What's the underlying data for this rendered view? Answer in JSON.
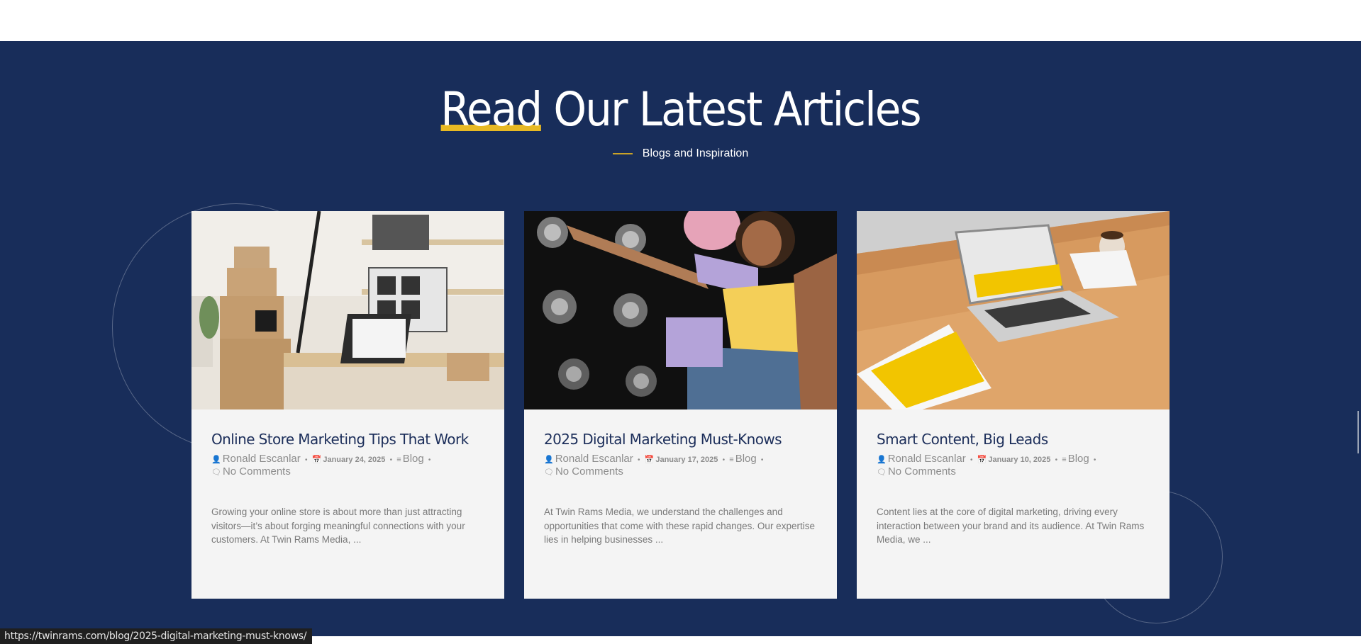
{
  "section": {
    "heading_highlight": "Read",
    "heading_rest": " Our Latest Articles",
    "subheading": "Blogs and Inspiration"
  },
  "colors": {
    "section_bg": "#182d5a",
    "accent": "#e8b923",
    "title": "#1c2e5a"
  },
  "cards": [
    {
      "title": "Online Store Marketing Tips That Work",
      "author": "Ronald Escanlar",
      "date": "January 24, 2025",
      "category": "Blog",
      "comments": "No Comments",
      "excerpt": "Growing your online store is about more than just attracting visitors—it’s about forging meaningful connections with your customers. At Twin Rams Media, ..."
    },
    {
      "title": "2025 Digital Marketing Must-Knows",
      "author": "Ronald Escanlar",
      "date": "January 17, 2025",
      "category": "Blog",
      "comments": "No Comments",
      "excerpt": "At Twin Rams Media, we understand the challenges and opportunities that come with these rapid changes. Our expertise lies in helping businesses ..."
    },
    {
      "title": "Smart Content, Big Leads",
      "author": "Ronald Escanlar",
      "date": "January 10, 2025",
      "category": "Blog",
      "comments": "No Comments",
      "excerpt": "Content lies at the core of digital marketing, driving every interaction between your brand and its audience. At Twin Rams Media, we ..."
    }
  ],
  "status_bar": {
    "url": "https://twinrams.com/blog/2025-digital-marketing-must-knows/"
  }
}
